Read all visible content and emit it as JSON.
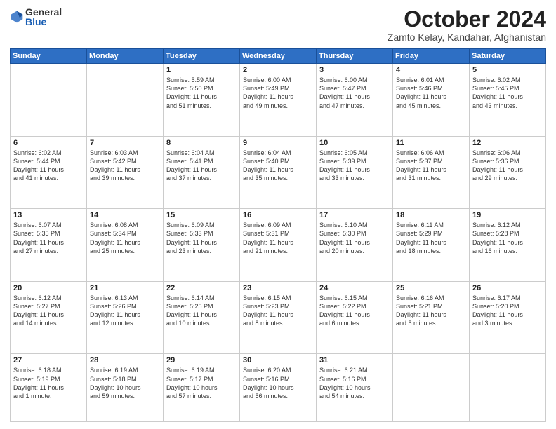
{
  "logo": {
    "general": "General",
    "blue": "Blue"
  },
  "title": "October 2024",
  "subtitle": "Zamto Kelay, Kandahar, Afghanistan",
  "days_of_week": [
    "Sunday",
    "Monday",
    "Tuesday",
    "Wednesday",
    "Thursday",
    "Friday",
    "Saturday"
  ],
  "weeks": [
    [
      {
        "day": "",
        "detail": ""
      },
      {
        "day": "",
        "detail": ""
      },
      {
        "day": "1",
        "detail": "Sunrise: 5:59 AM\nSunset: 5:50 PM\nDaylight: 11 hours\nand 51 minutes."
      },
      {
        "day": "2",
        "detail": "Sunrise: 6:00 AM\nSunset: 5:49 PM\nDaylight: 11 hours\nand 49 minutes."
      },
      {
        "day": "3",
        "detail": "Sunrise: 6:00 AM\nSunset: 5:47 PM\nDaylight: 11 hours\nand 47 minutes."
      },
      {
        "day": "4",
        "detail": "Sunrise: 6:01 AM\nSunset: 5:46 PM\nDaylight: 11 hours\nand 45 minutes."
      },
      {
        "day": "5",
        "detail": "Sunrise: 6:02 AM\nSunset: 5:45 PM\nDaylight: 11 hours\nand 43 minutes."
      }
    ],
    [
      {
        "day": "6",
        "detail": "Sunrise: 6:02 AM\nSunset: 5:44 PM\nDaylight: 11 hours\nand 41 minutes."
      },
      {
        "day": "7",
        "detail": "Sunrise: 6:03 AM\nSunset: 5:42 PM\nDaylight: 11 hours\nand 39 minutes."
      },
      {
        "day": "8",
        "detail": "Sunrise: 6:04 AM\nSunset: 5:41 PM\nDaylight: 11 hours\nand 37 minutes."
      },
      {
        "day": "9",
        "detail": "Sunrise: 6:04 AM\nSunset: 5:40 PM\nDaylight: 11 hours\nand 35 minutes."
      },
      {
        "day": "10",
        "detail": "Sunrise: 6:05 AM\nSunset: 5:39 PM\nDaylight: 11 hours\nand 33 minutes."
      },
      {
        "day": "11",
        "detail": "Sunrise: 6:06 AM\nSunset: 5:37 PM\nDaylight: 11 hours\nand 31 minutes."
      },
      {
        "day": "12",
        "detail": "Sunrise: 6:06 AM\nSunset: 5:36 PM\nDaylight: 11 hours\nand 29 minutes."
      }
    ],
    [
      {
        "day": "13",
        "detail": "Sunrise: 6:07 AM\nSunset: 5:35 PM\nDaylight: 11 hours\nand 27 minutes."
      },
      {
        "day": "14",
        "detail": "Sunrise: 6:08 AM\nSunset: 5:34 PM\nDaylight: 11 hours\nand 25 minutes."
      },
      {
        "day": "15",
        "detail": "Sunrise: 6:09 AM\nSunset: 5:33 PM\nDaylight: 11 hours\nand 23 minutes."
      },
      {
        "day": "16",
        "detail": "Sunrise: 6:09 AM\nSunset: 5:31 PM\nDaylight: 11 hours\nand 21 minutes."
      },
      {
        "day": "17",
        "detail": "Sunrise: 6:10 AM\nSunset: 5:30 PM\nDaylight: 11 hours\nand 20 minutes."
      },
      {
        "day": "18",
        "detail": "Sunrise: 6:11 AM\nSunset: 5:29 PM\nDaylight: 11 hours\nand 18 minutes."
      },
      {
        "day": "19",
        "detail": "Sunrise: 6:12 AM\nSunset: 5:28 PM\nDaylight: 11 hours\nand 16 minutes."
      }
    ],
    [
      {
        "day": "20",
        "detail": "Sunrise: 6:12 AM\nSunset: 5:27 PM\nDaylight: 11 hours\nand 14 minutes."
      },
      {
        "day": "21",
        "detail": "Sunrise: 6:13 AM\nSunset: 5:26 PM\nDaylight: 11 hours\nand 12 minutes."
      },
      {
        "day": "22",
        "detail": "Sunrise: 6:14 AM\nSunset: 5:25 PM\nDaylight: 11 hours\nand 10 minutes."
      },
      {
        "day": "23",
        "detail": "Sunrise: 6:15 AM\nSunset: 5:23 PM\nDaylight: 11 hours\nand 8 minutes."
      },
      {
        "day": "24",
        "detail": "Sunrise: 6:15 AM\nSunset: 5:22 PM\nDaylight: 11 hours\nand 6 minutes."
      },
      {
        "day": "25",
        "detail": "Sunrise: 6:16 AM\nSunset: 5:21 PM\nDaylight: 11 hours\nand 5 minutes."
      },
      {
        "day": "26",
        "detail": "Sunrise: 6:17 AM\nSunset: 5:20 PM\nDaylight: 11 hours\nand 3 minutes."
      }
    ],
    [
      {
        "day": "27",
        "detail": "Sunrise: 6:18 AM\nSunset: 5:19 PM\nDaylight: 11 hours\nand 1 minute."
      },
      {
        "day": "28",
        "detail": "Sunrise: 6:19 AM\nSunset: 5:18 PM\nDaylight: 10 hours\nand 59 minutes."
      },
      {
        "day": "29",
        "detail": "Sunrise: 6:19 AM\nSunset: 5:17 PM\nDaylight: 10 hours\nand 57 minutes."
      },
      {
        "day": "30",
        "detail": "Sunrise: 6:20 AM\nSunset: 5:16 PM\nDaylight: 10 hours\nand 56 minutes."
      },
      {
        "day": "31",
        "detail": "Sunrise: 6:21 AM\nSunset: 5:16 PM\nDaylight: 10 hours\nand 54 minutes."
      },
      {
        "day": "",
        "detail": ""
      },
      {
        "day": "",
        "detail": ""
      }
    ]
  ]
}
